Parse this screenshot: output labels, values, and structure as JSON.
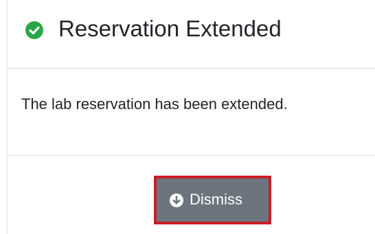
{
  "colors": {
    "success_accent": "#28a745",
    "button_background": "#6c757d",
    "button_focus_border": "#c81e24",
    "text": "#212529",
    "divider": "#dcdcdc"
  },
  "modal": {
    "title": "Reservation Extended",
    "title_icon": "check-circle-icon",
    "message": "The lab reservation has been extended.",
    "dismiss_button": {
      "label": "Dismiss",
      "icon": "arrow-circle-down-icon"
    }
  }
}
